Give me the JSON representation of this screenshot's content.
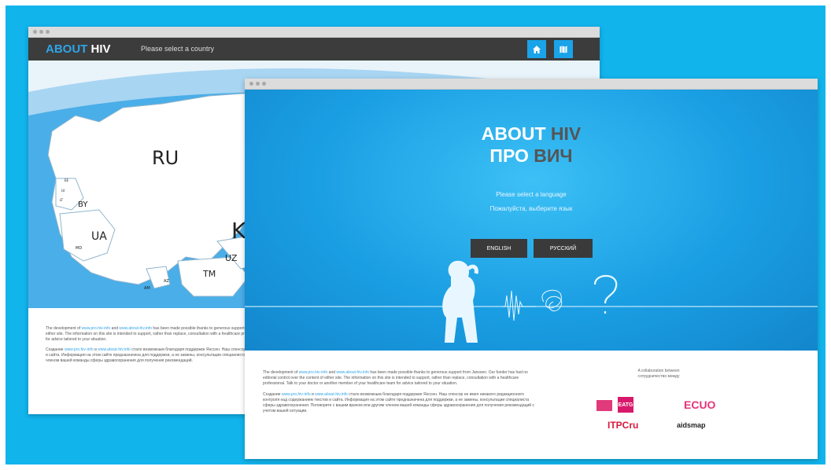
{
  "back_window": {
    "logo_about": "ABOUT",
    "logo_hiv": "HIV",
    "country_prompt": "Please select a country",
    "map_labels": [
      "RU",
      "K",
      "BY",
      "UA",
      "UZ",
      "TM",
      "LT",
      "LV",
      "EE",
      "MD",
      "AM",
      "AZ"
    ],
    "footer_en": {
      "prefix": "The development of ",
      "link1": "www.pro.hiv-info",
      "mid": " and ",
      "link2": "www.about-hiv.info",
      "rest": " has been made possible thanks to generous support from Janssen. Our funder has had no editorial control over the content of either site. The information on this site is intended to support, rather than replace, consultation with a healthcare professional. Talk to your doctor or another member of your healthcare team for advice tailored to your situation."
    },
    "footer_ru": {
      "prefix": "Создание ",
      "link1": "www.pro.hiv-info",
      "mid": " и ",
      "link2": "www.about-hiv.info",
      "rest": " стало возможным благодаря поддержке Янссен. Наш спонсор не имел никакого редакционного контроля над содержанием текстов и сайта. Информация на этом сайте предназначена для поддержки, а не замены, консультации специалиста сферы здравоохранения. Поговорите с вашим врачом или другим членом вашей команды сферы здравоохранения для получения рекомендаций."
    }
  },
  "front_window": {
    "title_line1_white": "ABOUT",
    "title_line1_grey": "HIV",
    "title_line2_white": "ПРО",
    "title_line2_grey": "ВИЧ",
    "lang_prompt_en": "Please select a language",
    "lang_prompt_ru": "Пожалуйста, выберите язык",
    "btn_english": "ENGLISH",
    "btn_russian": "РУССКИЙ",
    "footer_en": {
      "prefix": "The development of ",
      "link1": "www.pro.hiv-info",
      "mid": " and ",
      "link2": "www.about-hiv.info",
      "rest": " has been made possible thanks to generous support from Janssen. Our funder has had no editorial control over the content of either site. The information on this site is intended to support, rather than replace, consultation with a healthcare professional. Talk to your doctor or another member of your healthcare team for advice tailored to your situation."
    },
    "footer_ru": {
      "prefix": "Создание ",
      "link1": "www.pro.hiv-info",
      "mid": " и ",
      "link2": "www.about-hiv.info",
      "rest": " стало возможным благодаря поддержке Янссен. Наш спонсор не имел никакого редакционного контроля над содержанием текстов и сайта. Информация на этом сайте предназначена для поддержки, а не замены, консультации специалиста сферы здравоохранения. Поговорите с вашим врачом или другим членом вашей команды сферы здравоохранения для получения рекомендаций с учетом вашей ситуации."
    },
    "collab_en": "A collaboration between",
    "collab_ru": "сотрудничество между",
    "partner_logos": [
      "EATG",
      "ECUO",
      "ITPCru",
      "aidsmap"
    ]
  },
  "colors": {
    "background": "#12b4ec",
    "accent_blue": "#2fa4e7",
    "topbar": "#3c3c3c",
    "button_dark": "#3a3a3a"
  },
  "icons": [
    "home-icon",
    "map-icon",
    "window-dot-icon"
  ]
}
